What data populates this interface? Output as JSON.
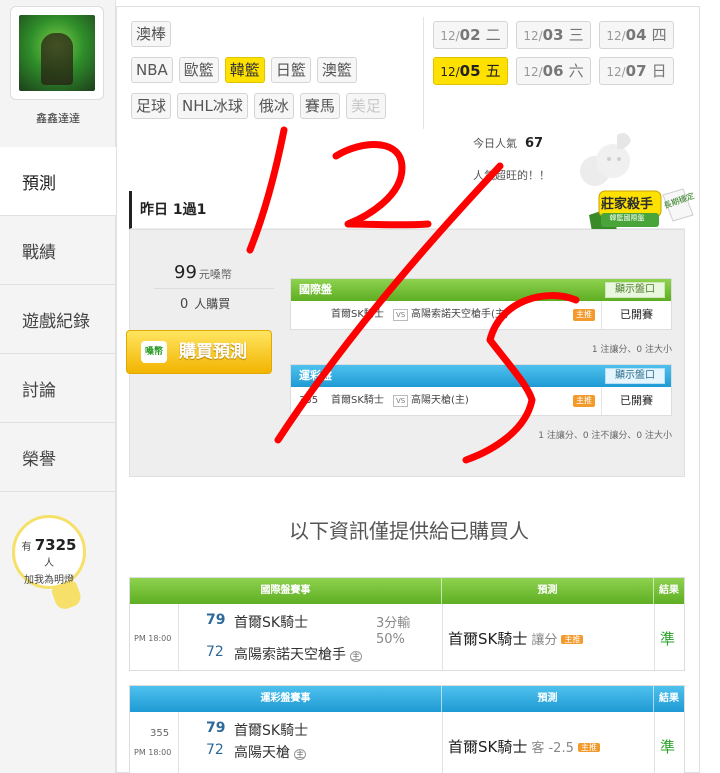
{
  "user": {
    "name": "鑫鑫達達"
  },
  "nav": [
    {
      "label": "預測",
      "active": true
    },
    {
      "label": "戰績",
      "active": false
    },
    {
      "label": "遊戲紀錄",
      "active": false
    },
    {
      "label": "討論",
      "active": false
    },
    {
      "label": "榮譽",
      "active": false
    }
  ],
  "bulb": {
    "prefix": "有",
    "count": "7325",
    "suffix": "人",
    "line2": "加我為明燈"
  },
  "sport_tabs": [
    [
      {
        "label": "澳棒"
      }
    ],
    [
      {
        "label": "NBA"
      },
      {
        "label": "歐籃"
      },
      {
        "label": "韓籃"
      },
      {
        "label": "日籃"
      },
      {
        "label": "澳籃"
      }
    ],
    [
      {
        "label": "足球"
      },
      {
        "label": "NHL冰球"
      },
      {
        "label": "俄冰"
      },
      {
        "label": "賽馬"
      },
      {
        "label": "美足"
      }
    ]
  ],
  "dates": [
    {
      "md": "12/",
      "dd": "02",
      "wd": "二"
    },
    {
      "md": "12/",
      "dd": "03",
      "wd": "三"
    },
    {
      "md": "12/",
      "dd": "04",
      "wd": "四"
    },
    {
      "md": "12/",
      "dd": "05",
      "wd": "五"
    },
    {
      "md": "12/",
      "dd": "06",
      "wd": "六"
    },
    {
      "md": "12/",
      "dd": "07",
      "wd": "日"
    }
  ],
  "popularity": {
    "label": "今日人氣",
    "value": "67",
    "message": "人氣超旺的！！"
  },
  "badge": {
    "main": "莊家殺手",
    "sub": "韓籃國際盤",
    "side": "長期穩定"
  },
  "yesterday": "昨日 1過1",
  "price": {
    "amount": "99",
    "unit": "元嗓幣",
    "buyers": "0",
    "buyers_label": "人購買"
  },
  "buy_button": {
    "label": "購買預測",
    "icon_text": "嗓幣"
  },
  "intl_market": {
    "title": "國際盤",
    "show_label": "顯示盤口",
    "number": "",
    "team1": "首爾SK騎士",
    "vs": "VS",
    "team2": "高陽索諾天空槍手(主)",
    "tag": "主推",
    "status": "已開賽",
    "note": "1 注讓分、0 注大小"
  },
  "sport_market": {
    "title": "運彩盤",
    "show_label": "顯示盤口",
    "number": "355",
    "team1": "首爾SK騎士",
    "vs": "VS",
    "team2": "高陽天槍(主)",
    "tag": "主推",
    "status": "已開賽",
    "note": "1 注讓分、0 注不讓分、0 注大小"
  },
  "info_title": "以下資訊僅提供給已購買人",
  "table1": {
    "headers": [
      "國際盤賽事",
      "預測",
      "結果"
    ],
    "time": "PM 18:00",
    "number": "",
    "score1": "79",
    "team1": "首爾SK騎士",
    "score2": "72",
    "team2": "高陽索諾天空槍手",
    "home_mark": "主",
    "odds": "3分輸",
    "pct": "50%",
    "pick": "首爾SK騎士",
    "pick_type": "讓分",
    "pick_tag": "主推",
    "result": "準"
  },
  "table2": {
    "headers": [
      "運彩盤賽事",
      "預測",
      "結果"
    ],
    "time": "PM 18:00",
    "number": "355",
    "score1": "79",
    "team1": "首爾SK騎士",
    "score2": "72",
    "team2": "高陽天槍",
    "home_mark": "主",
    "odds": "",
    "pct": "",
    "pick": "首爾SK騎士",
    "pick_type": "客 -2.5",
    "pick_tag": "主推",
    "result": "準"
  },
  "colors": {
    "accent_yellow": "#ffe100",
    "green": "#5eae22",
    "blue": "#1e9ad4",
    "ink": "#ff0000"
  }
}
